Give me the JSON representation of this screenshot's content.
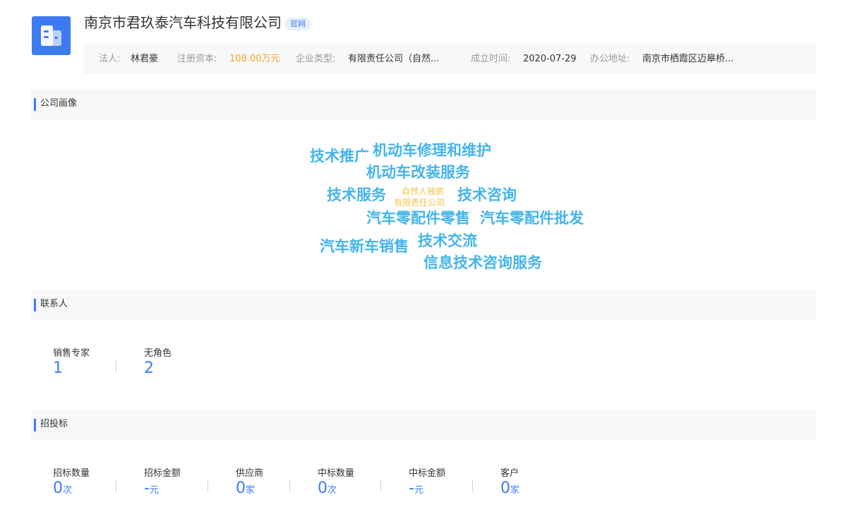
{
  "company": {
    "name": "南京市君玖泰汽车科技有限公司",
    "official_site_badge": "官网",
    "logo_icon": "building-icon",
    "info": {
      "legal_person_label": "法人:",
      "legal_person": "林君豪",
      "capital_label": "注册资本:",
      "capital": "108.00万元",
      "type_label": "企业类型:",
      "type": "有限责任公司（自然...",
      "founded_label": "成立时间:",
      "founded": "2020-07-29",
      "address_label": "办公地址:",
      "address": "南京市栖霞区迈皋桥..."
    }
  },
  "sections": {
    "portrait": "公司画像",
    "contacts": "联系人",
    "bidding": "招投标"
  },
  "word_cloud": {
    "words": [
      "技术推广",
      "机动车修理和维护",
      "机动车改装服务",
      "技术服务",
      "技术咨询",
      "汽车零配件零售",
      "汽车零配件批发",
      "汽车新车销售",
      "技术交流",
      "信息技术咨询服务"
    ],
    "small_words": [
      "自然人独资",
      "有限责任公司"
    ],
    "colors": {
      "primary": "#45b5ea",
      "secondary": "#f5c242"
    }
  },
  "contacts": [
    {
      "label": "销售专家",
      "value": "1"
    },
    {
      "label": "无角色",
      "value": "2"
    }
  ],
  "bidding": [
    {
      "label": "招标数量",
      "value": "0",
      "unit": "次"
    },
    {
      "label": "招标金额",
      "value": "-",
      "unit": "元"
    },
    {
      "label": "供应商",
      "value": "0",
      "unit": "家"
    },
    {
      "label": "中标数量",
      "value": "0",
      "unit": "次"
    },
    {
      "label": "中标金额",
      "value": "-",
      "unit": "元"
    },
    {
      "label": "客户",
      "value": "0",
      "unit": "家"
    }
  ],
  "colors": {
    "accent": "#3c7bf0",
    "highlight": "#f5a623",
    "section_bg": "#f7f8fa"
  }
}
